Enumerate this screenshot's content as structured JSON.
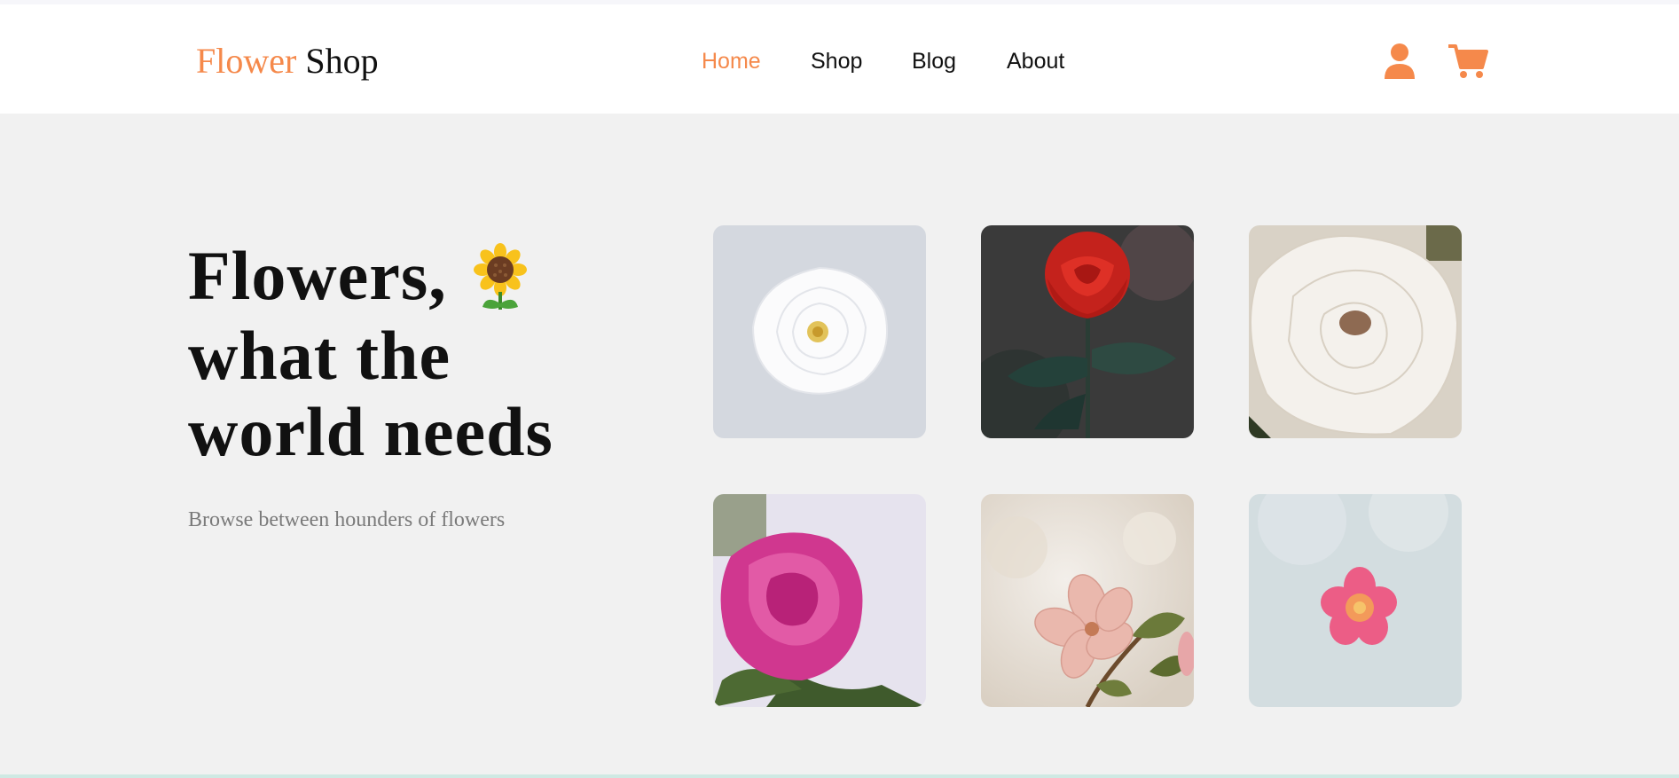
{
  "brand": {
    "part1": "Flower",
    "part2": "Shop"
  },
  "nav": {
    "items": [
      "Home",
      "Shop",
      "Blog",
      "About"
    ],
    "active": "Home"
  },
  "header_icons": [
    "user-icon",
    "cart-icon"
  ],
  "hero": {
    "title_line1": "Flowers,",
    "title_line2": "what the",
    "title_line3": "world needs",
    "emoji_icon": "sunflower-icon",
    "subtitle": "Browse between hounders of flowers"
  },
  "gallery": [
    "white-rose-image",
    "red-rose-image",
    "white-peony-image",
    "pink-peony-image",
    "cherry-blossom-image",
    "pink-flower-image"
  ],
  "colors": {
    "accent": "#f5894b",
    "text": "#111111",
    "muted": "#7a7a7a",
    "background": "#f1f1f1",
    "header": "#ffffff"
  }
}
